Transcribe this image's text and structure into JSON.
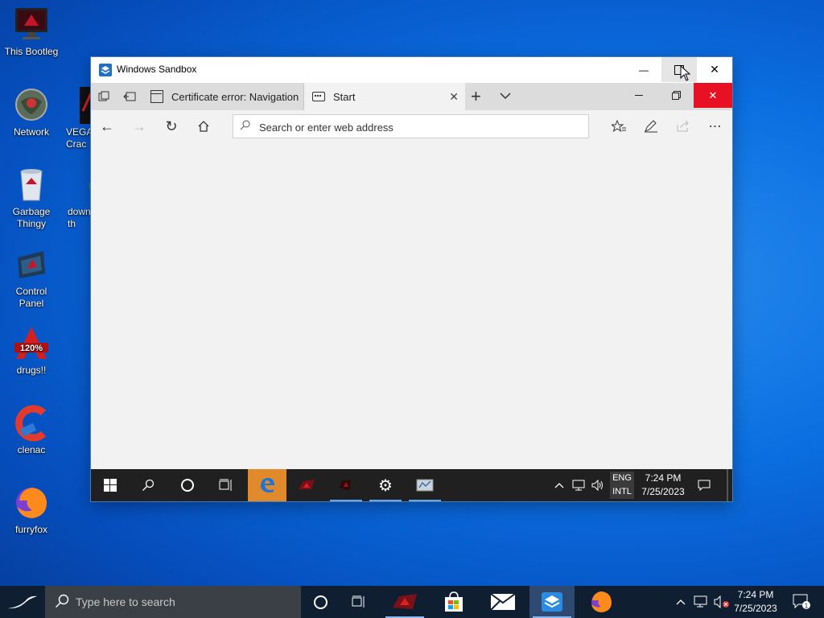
{
  "desktop": {
    "icons": [
      {
        "label": "This Bootleg"
      },
      {
        "label": "Network"
      },
      {
        "label": "VEGA\nCrac"
      },
      {
        "label": "Garbage\nThingy"
      },
      {
        "label": "down\nth"
      },
      {
        "label": "Control\nPanel"
      },
      {
        "label": "drugs!!",
        "badge": "120%"
      },
      {
        "label": "clenac"
      },
      {
        "label": "furryfox"
      }
    ]
  },
  "sandbox": {
    "title": "Windows Sandbox",
    "minimize": "—",
    "maximize": "☐",
    "close": "✕"
  },
  "edge": {
    "tabs": [
      {
        "label": "Certificate error: Navigation"
      },
      {
        "label": "Start"
      }
    ],
    "tab_close": "✕",
    "new_tab": "+",
    "tab_menu": "⌵",
    "address_placeholder": "Search or enter web address"
  },
  "inner_taskbar": {
    "lang_top": "ENG",
    "lang_bottom": "INTL",
    "time": "7:24 PM",
    "date": "7/25/2023"
  },
  "taskbar": {
    "search_placeholder": "Type here to search",
    "time": "7:24 PM",
    "date": "7/25/2023",
    "notification_count": "1"
  },
  "colors": {
    "edge_close": "#e81123",
    "active_task": "#e08a2c",
    "desktop": "#0b6fe0"
  }
}
